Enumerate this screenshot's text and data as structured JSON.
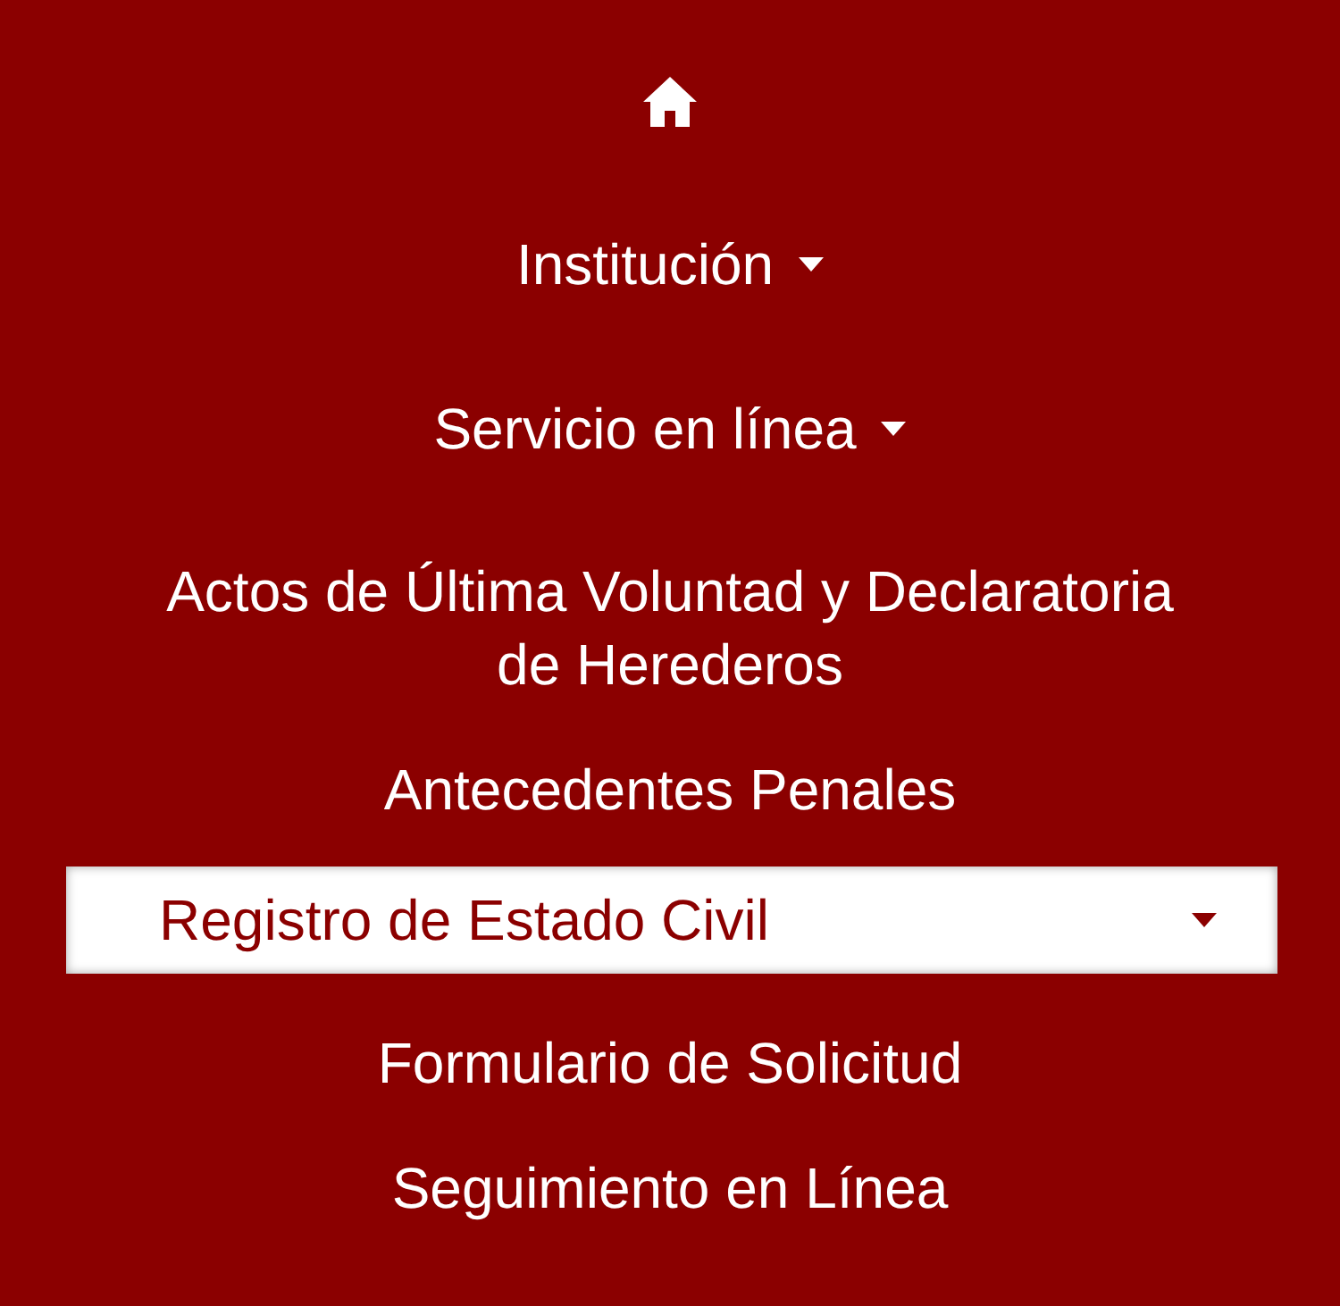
{
  "menu": {
    "items": [
      {
        "label": "Institución",
        "dropdown": true
      },
      {
        "label": "Servicio en línea",
        "dropdown": true,
        "children": [
          {
            "label": "Actos de Última Voluntad y Declaratoria de Herederos",
            "dropdown": false,
            "selected": false
          },
          {
            "label": "Antecedentes Penales",
            "dropdown": false,
            "selected": false
          },
          {
            "label": "Registro de Estado Civil",
            "dropdown": true,
            "selected": true
          },
          {
            "label": "Formulario de Solicitud",
            "dropdown": false,
            "selected": false
          },
          {
            "label": "Seguimiento en Línea",
            "dropdown": false,
            "selected": false
          }
        ]
      }
    ]
  }
}
